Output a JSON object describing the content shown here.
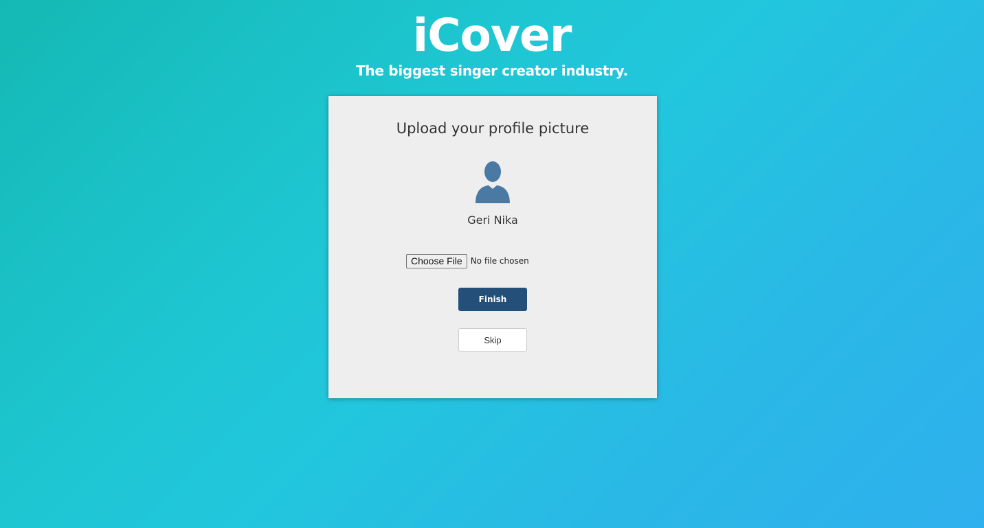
{
  "brand": {
    "title": "iCover",
    "tagline": "The biggest singer creator industry."
  },
  "card": {
    "heading": "Upload your profile picture",
    "avatar_icon": "user-silhouette-icon",
    "user_name": "Geri Nika",
    "file_input": {
      "button_label": "Choose File",
      "status": "No file chosen"
    },
    "finish_label": "Finish",
    "skip_label": "Skip"
  },
  "colors": {
    "gradient_start": "#14b9b4",
    "gradient_end": "#2fb0ee",
    "card_background": "#eeeeee",
    "finish_button": "#234f78",
    "avatar": "#4a7aa3"
  }
}
